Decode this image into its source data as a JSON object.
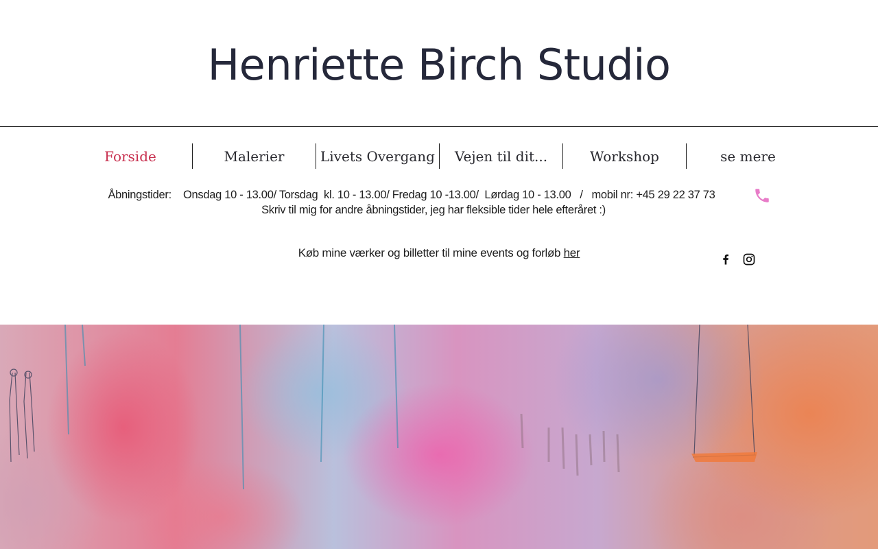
{
  "site": {
    "title": "Henriette Birch Studio"
  },
  "nav": {
    "items": [
      {
        "label": "Forside",
        "active": true
      },
      {
        "label": "Malerier",
        "active": false
      },
      {
        "label": "Livets Overgang",
        "active": false
      },
      {
        "label": "Vejen til dit...",
        "active": false
      },
      {
        "label": "Workshop",
        "active": false
      },
      {
        "label": "se mere",
        "active": false
      }
    ],
    "active_color": "#c8304f"
  },
  "info": {
    "hours_line": "Åbningstider:    Onsdag 10 - 13.00/ Torsdag  kl. 10 - 13.00/ Fredag 10 -13.00/  Lørdag 10 - 13.00   /   mobil nr: +45 29 22 37 73",
    "flex_line": "Skriv til mig for andre åbningstider, jeg har fleksible tider hele efteråret :)",
    "phone_icon": "phone-icon",
    "phone_icon_color": "#e87cc8"
  },
  "shop": {
    "text": "Køb mine værker og billetter til mine events og forløb ",
    "link_label": "her"
  },
  "social": {
    "icons": [
      "facebook-icon",
      "instagram-icon"
    ]
  },
  "hero": {
    "description_icon": "abstract-painting"
  }
}
